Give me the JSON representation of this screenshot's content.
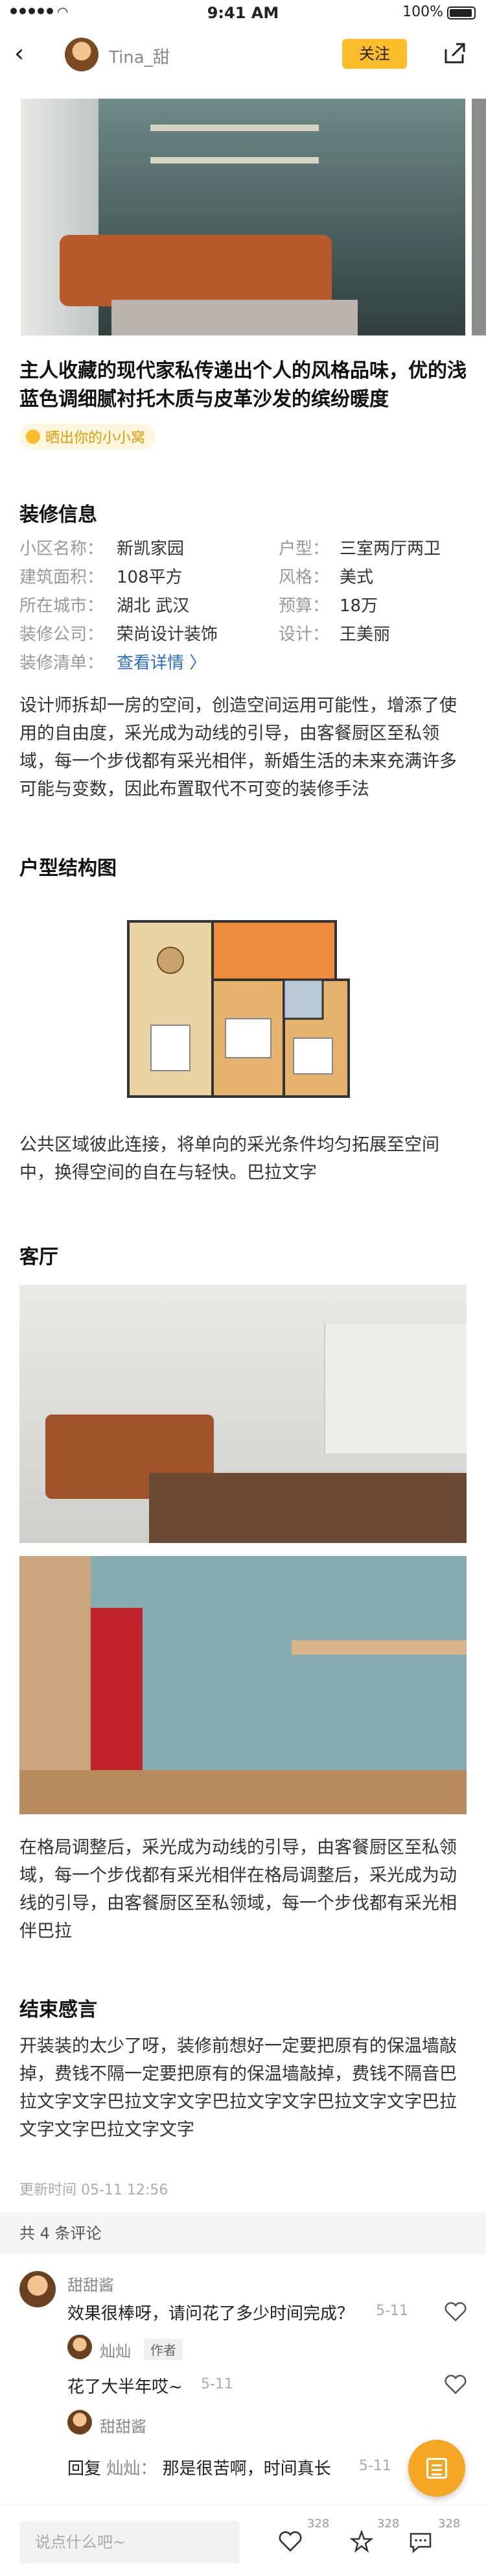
{
  "status_bar": {
    "time": "9:41 AM",
    "battery": "100%"
  },
  "nav": {
    "username": "Tina_甜",
    "follow_label": "关注"
  },
  "post": {
    "title": "主人收藏的现代家私传递出个人的风格品味，优的浅蓝色调细腻衬托木质与皮革沙发的缤纷暖度",
    "tag": "晒出你的小小窝"
  },
  "info": {
    "heading": "装修信息",
    "rows": [
      [
        {
          "k": "小区名称：",
          "v": "新凯家园"
        },
        {
          "k": "户型：",
          "v": "三室两厅两卫"
        }
      ],
      [
        {
          "k": "建筑面积：",
          "v": "108平方"
        },
        {
          "k": "风格：",
          "v": "美式"
        }
      ],
      [
        {
          "k": "所在城市：",
          "v": "湖北 武汉"
        },
        {
          "k": "预算：",
          "v": "18万"
        }
      ],
      [
        {
          "k": "装修公司：",
          "v": "荣尚设计装饰"
        },
        {
          "k": "设计：",
          "v": "王美丽"
        }
      ],
      [
        {
          "k": "装修清单：",
          "v": "查看详情 〉"
        }
      ]
    ],
    "description": "设计师拆却一房的空间，创造空间运用可能性，增添了使用的自由度，采光成为动线的引导，由客餐厨区至私领域，每一个步伐都有采光相伴，新婚生活的未来充满许多可能与变数，因此布置取代不可变的装修手法"
  },
  "floorplan": {
    "heading": "户型结构图",
    "caption": "公共区域彼此连接，将单向的采光条件均匀拓展至空间中，换得空间的自在与轻快。巴拉文字"
  },
  "living": {
    "heading": "客厅",
    "caption": "在格局调整后，采光成为动线的引导，由客餐厨区至私领域，每一个步伐都有采光相伴在格局调整后，采光成为动线的引导，由客餐厨区至私领域，每一个步伐都有采光相伴巴拉"
  },
  "ending": {
    "heading": "结束感言",
    "text": "开装装的太少了呀，装修前想好一定要把原有的保温墙敲掉，费钱不隔一定要把原有的保温墙敲掉，费钱不隔音巴拉文字文字巴拉文字文字巴拉文字文字巴拉文字文字巴拉文字文字巴拉文字文字",
    "updated": "更新时间 05-11 12:56"
  },
  "comments": {
    "header": "共 4 条评论",
    "items": [
      {
        "name": "甜甜酱",
        "text": "效果很棒呀，请问花了多少时间完成？",
        "date": "5-11"
      },
      {
        "name": "灿灿",
        "author_tag": "作者",
        "text": "花了大半年哎~",
        "date": "5-11"
      },
      {
        "name": "甜甜酱",
        "reply_prefix": "回复",
        "reply_to": "灿灿：",
        "text": "那是很苦啊，时间真长",
        "date": "5-11"
      }
    ]
  },
  "bottom_bar": {
    "placeholder": "说点什么吧~",
    "like_count": "328",
    "fav_count": "328",
    "comment_count": "328"
  }
}
